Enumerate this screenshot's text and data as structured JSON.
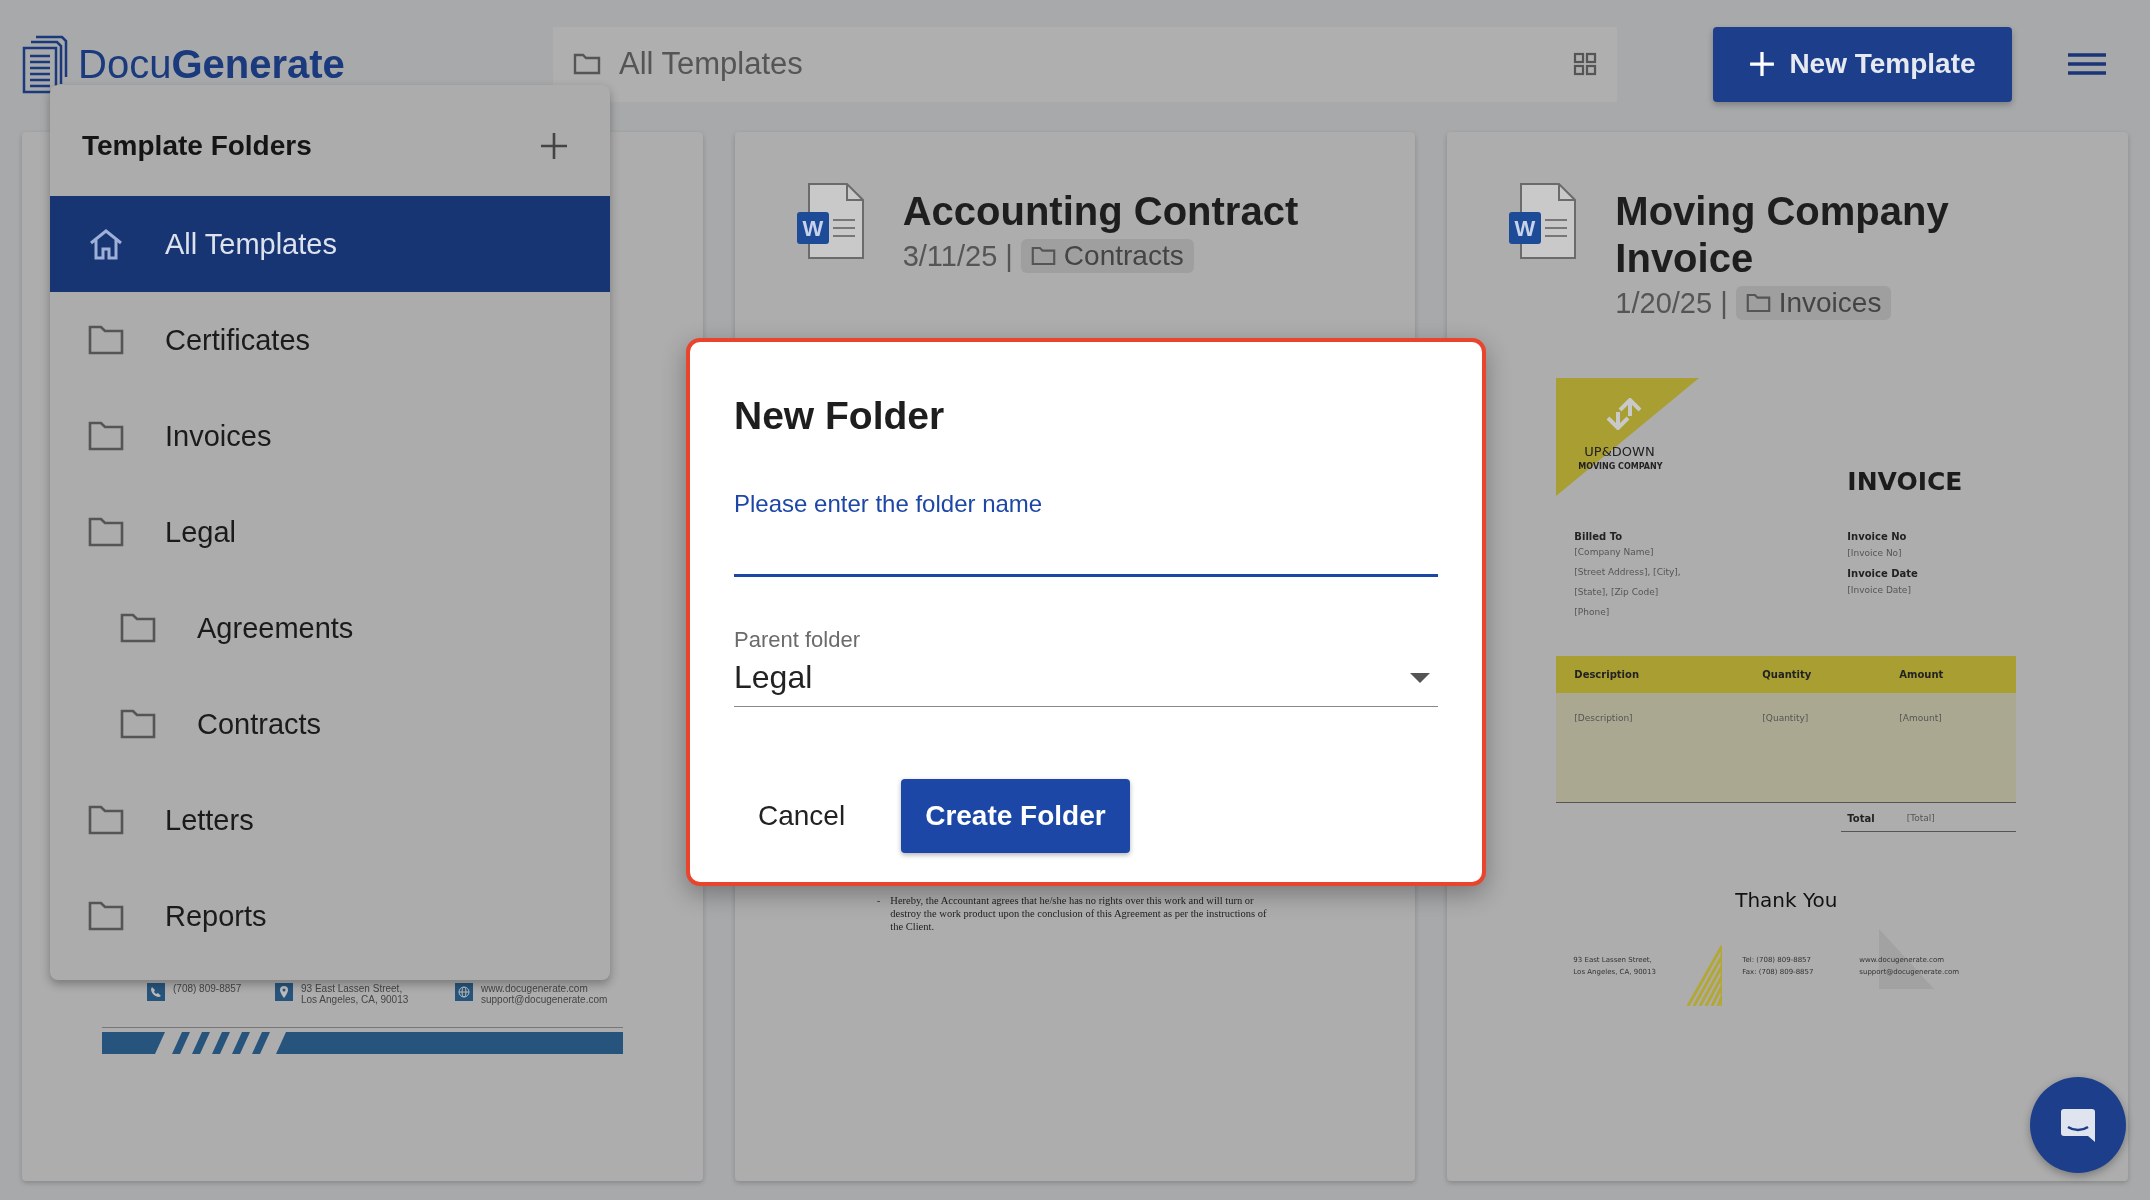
{
  "header": {
    "logo": {
      "light": "Docu",
      "bold": "Generate"
    },
    "location": {
      "label": "All Templates"
    },
    "new_button": {
      "label": "New Template"
    }
  },
  "cards": [
    {
      "kind": "letter",
      "footer": {
        "phone": "(708) 809-8857",
        "address": [
          "93 East Lassen Street,",
          "Los Angeles, CA, 90013"
        ],
        "web": [
          "www.docugenerate.com",
          "support@docugenerate.com"
        ]
      }
    },
    {
      "kind": "contract",
      "file_badge": "W",
      "title": "Accounting Contract",
      "date": "3/11/25 |",
      "folder": "Contracts",
      "excerpt": {
        "bullet": "-",
        "text": "Hereby, the Accountant agrees that he/she has no rights over this work and will turn or destroy the work product upon the conclusion of this Agreement as per the instructions of the Client."
      }
    },
    {
      "kind": "invoice",
      "file_badge": "W",
      "title": "Moving Company Invoice",
      "date": "1/20/25 |",
      "folder": "Invoices",
      "invoice": {
        "brand": "UP&DOWN",
        "brand_sub": "MOVING COMPANY",
        "heading": "INVOICE",
        "billed_to": {
          "label": "Billed To",
          "lines": [
            "[Company Name]",
            "[Street Address], [City],",
            "[State], [Zip Code]",
            "[Phone]"
          ]
        },
        "meta": [
          {
            "label": "Invoice No",
            "value": "[Invoice No]"
          },
          {
            "label": "Invoice Date",
            "value": "[Invoice Date]"
          }
        ],
        "columns": [
          "Description",
          "Quantity",
          "Amount"
        ],
        "row": [
          "[Description]",
          "[Quantity]",
          "[Amount]"
        ],
        "total": {
          "label": "Total",
          "value": "[Total]"
        },
        "closing": "Thank You",
        "footer": {
          "address": [
            "93 East Lassen Street,",
            "Los Angeles, CA, 90013"
          ],
          "phone": [
            "Tel:  (708) 809-8857",
            "Fax: (708) 809-8857"
          ],
          "web": [
            "www.docugenerate.com",
            "support@docugenerate.com"
          ]
        }
      }
    }
  ],
  "folder_menu": {
    "title": "Template Folders",
    "items": [
      {
        "label": "All Templates",
        "kind": "home",
        "selected": true
      },
      {
        "label": "Certificates",
        "kind": "folder",
        "selected": false
      },
      {
        "label": "Invoices",
        "kind": "folder",
        "selected": false
      },
      {
        "label": "Legal",
        "kind": "folder",
        "selected": false,
        "children": [
          {
            "label": "Agreements",
            "kind": "folder",
            "selected": false
          },
          {
            "label": "Contracts",
            "kind": "folder",
            "selected": false
          }
        ]
      },
      {
        "label": "Letters",
        "kind": "folder",
        "selected": false
      },
      {
        "label": "Reports",
        "kind": "folder",
        "selected": false
      }
    ]
  },
  "dialog": {
    "highlighted": true,
    "title": "New Folder",
    "name_field": {
      "label": "Please enter the folder name",
      "focused": true
    },
    "parent_field": {
      "label": "Parent folder",
      "value": "Legal"
    },
    "buttons": [
      {
        "label": "Cancel",
        "kind": "text"
      },
      {
        "label": "Create Folder",
        "kind": "primary"
      }
    ]
  }
}
